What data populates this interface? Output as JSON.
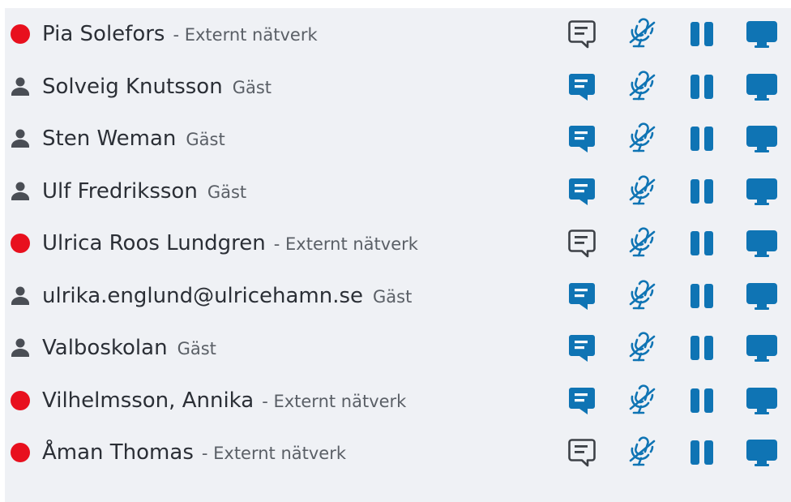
{
  "colors": {
    "accent": "#0f74b4",
    "offline_red": "#e8101e",
    "outline_icon": "#3d4147",
    "person_icon": "#4a4e55",
    "panel_bg": "#eff1f5"
  },
  "participants": [
    {
      "name": "Pia Solefors",
      "sub": "- Externt nätverk",
      "status": "offline-dot",
      "chat": "outline"
    },
    {
      "name": "Solveig Knutsson",
      "sub": "Gäst",
      "status": "person-icon",
      "chat": "filled"
    },
    {
      "name": "Sten Weman",
      "sub": "Gäst",
      "status": "person-icon",
      "chat": "filled"
    },
    {
      "name": "Ulf Fredriksson",
      "sub": "Gäst",
      "status": "person-icon",
      "chat": "filled"
    },
    {
      "name": "Ulrica Roos Lundgren",
      "sub": "- Externt nätverk",
      "status": "offline-dot",
      "chat": "outline"
    },
    {
      "name": "ulrika.englund@ulricehamn.se",
      "sub": "Gäst",
      "status": "person-icon",
      "chat": "filled"
    },
    {
      "name": "Valboskolan",
      "sub": "Gäst",
      "status": "person-icon",
      "chat": "filled"
    },
    {
      "name": "Vilhelmsson, Annika",
      "sub": "- Externt nätverk",
      "status": "offline-dot",
      "chat": "filled"
    },
    {
      "name": "Åman Thomas",
      "sub": "- Externt nätverk",
      "status": "offline-dot",
      "chat": "outline"
    }
  ],
  "icons": {
    "chat": "chat-icon",
    "mic_muted": "microphone-muted-icon",
    "pause": "pause-icon",
    "screen": "monitor-icon",
    "offline": "offline-dot-icon",
    "guest": "person-icon"
  }
}
